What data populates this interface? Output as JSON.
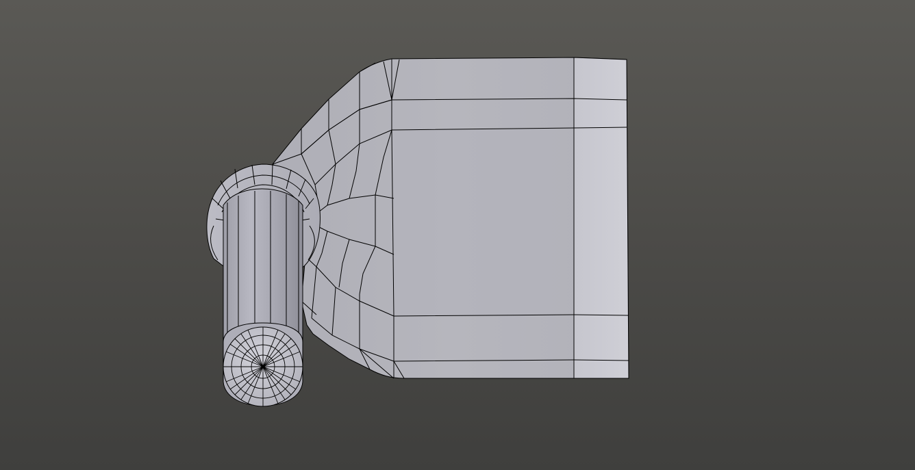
{
  "viewport": {
    "background_top": "#5a5955",
    "background_bottom": "#3f3f3d"
  },
  "mesh": {
    "object": "bracket-with-cylindrical-pin",
    "view": "solid-shading-with-wireframe-edges",
    "surface_color": "#b4b4be",
    "surface_light_color": "#cacad2",
    "edge_color": "#000000"
  }
}
